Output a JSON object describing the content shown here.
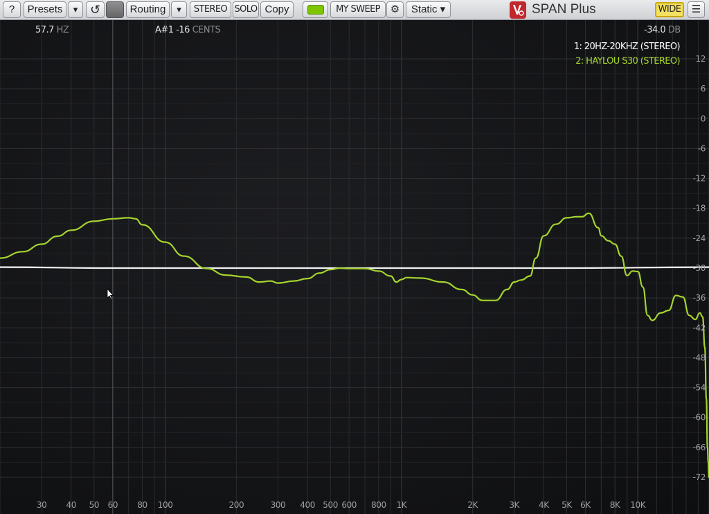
{
  "toolbar": {
    "help_label": "?",
    "presets_label": "Presets",
    "presets_arrow": "▾",
    "reset_icon": "↺",
    "routing_label": "Routing",
    "routing_arrow": "▾",
    "stereo_label": "STEREO",
    "solo_label": "SOLO",
    "copy_label": "Copy",
    "sweep_label": "MY SWEEP",
    "settings_icon": "⚙",
    "mode_label": "Static ▾",
    "brand": "SPAN Plus",
    "wide_label": "WIDE",
    "menu_icon": "☰"
  },
  "readouts": {
    "freq_value": "57.7",
    "freq_unit": "HZ",
    "note_value": "A#1",
    "cents_value": "-16",
    "cents_unit": "CENTS",
    "db_value": "-34.0",
    "db_unit": "DB"
  },
  "legend": [
    {
      "label": "1: 20HZ-20KHZ (STEREO)",
      "color": "#ffffff"
    },
    {
      "label": "2: HAYLOU S30 (STEREO)",
      "color": "#a6d42e"
    }
  ],
  "colors": {
    "accent_green": "#7ec500",
    "trace_green": "#a6d42e",
    "trace_white": "#f2f2f2",
    "wide_yellow": "#f4e060"
  },
  "chart_data": {
    "type": "line",
    "x_scale": "log",
    "xlim": [
      20,
      20000
    ],
    "ylim": [
      -72,
      12
    ],
    "grid": true,
    "x_ticks": [
      {
        "v": 30,
        "label": "30"
      },
      {
        "v": 40,
        "label": "40"
      },
      {
        "v": 50,
        "label": "50"
      },
      {
        "v": 60,
        "label": "60"
      },
      {
        "v": 80,
        "label": "80"
      },
      {
        "v": 100,
        "label": "100"
      },
      {
        "v": 200,
        "label": "200"
      },
      {
        "v": 300,
        "label": "300"
      },
      {
        "v": 400,
        "label": "400"
      },
      {
        "v": 500,
        "label": "500"
      },
      {
        "v": 600,
        "label": "600"
      },
      {
        "v": 800,
        "label": "800"
      },
      {
        "v": 1000,
        "label": "1K"
      },
      {
        "v": 2000,
        "label": "2K"
      },
      {
        "v": 3000,
        "label": "3K"
      },
      {
        "v": 4000,
        "label": "4K"
      },
      {
        "v": 5000,
        "label": "5K"
      },
      {
        "v": 6000,
        "label": "6K"
      },
      {
        "v": 8000,
        "label": "8K"
      },
      {
        "v": 10000,
        "label": "10K"
      }
    ],
    "y_ticks": [
      12,
      6,
      0,
      -6,
      -12,
      -18,
      -24,
      -30,
      -36,
      -42,
      -48,
      -54,
      -60,
      -66,
      -72
    ],
    "series": [
      {
        "name": "1: 20HZ-20KHZ (STEREO)",
        "color": "#f2f2f2",
        "points": [
          [
            20,
            -29.8
          ],
          [
            60,
            -30
          ],
          [
            150,
            -30
          ],
          [
            1000,
            -30
          ],
          [
            5000,
            -30
          ],
          [
            20000,
            -29.8
          ]
        ]
      },
      {
        "name": "2: HAYLOU S30 (STEREO)",
        "color": "#a6d42e",
        "points": [
          [
            20,
            -28
          ],
          [
            25,
            -26.7
          ],
          [
            30,
            -25.2
          ],
          [
            35,
            -23.6
          ],
          [
            40,
            -22.4
          ],
          [
            50,
            -20.6
          ],
          [
            60,
            -20.1
          ],
          [
            70,
            -19.9
          ],
          [
            75,
            -20.1
          ],
          [
            80,
            -21.3
          ],
          [
            100,
            -24.8
          ],
          [
            120,
            -27.6
          ],
          [
            150,
            -30.1
          ],
          [
            180,
            -31.4
          ],
          [
            220,
            -31.8
          ],
          [
            250,
            -32.8
          ],
          [
            280,
            -32.6
          ],
          [
            300,
            -33
          ],
          [
            350,
            -32.6
          ],
          [
            400,
            -32.1
          ],
          [
            450,
            -31
          ],
          [
            500,
            -30.3
          ],
          [
            550,
            -30
          ],
          [
            600,
            -30.1
          ],
          [
            700,
            -30.1
          ],
          [
            800,
            -30.6
          ],
          [
            900,
            -31.6
          ],
          [
            950,
            -32.8
          ],
          [
            1000,
            -32.3
          ],
          [
            1050,
            -31.9
          ],
          [
            1200,
            -32
          ],
          [
            1500,
            -32.8
          ],
          [
            1800,
            -34.3
          ],
          [
            2000,
            -35.4
          ],
          [
            2200,
            -36.5
          ],
          [
            2500,
            -36.5
          ],
          [
            2800,
            -34.3
          ],
          [
            3000,
            -32.8
          ],
          [
            3200,
            -32.4
          ],
          [
            3500,
            -31.6
          ],
          [
            3700,
            -28
          ],
          [
            4000,
            -23.5
          ],
          [
            4500,
            -21.2
          ],
          [
            5000,
            -19.9
          ],
          [
            5500,
            -19.7
          ],
          [
            5800,
            -19.7
          ],
          [
            6200,
            -19
          ],
          [
            6800,
            -21.9
          ],
          [
            7000,
            -23.5
          ],
          [
            7500,
            -24.5
          ],
          [
            8000,
            -25.2
          ],
          [
            8500,
            -27.6
          ],
          [
            9000,
            -31.5
          ],
          [
            9500,
            -30.6
          ],
          [
            10000,
            -30.7
          ],
          [
            10500,
            -33.8
          ],
          [
            11000,
            -39.5
          ],
          [
            11500,
            -40.5
          ],
          [
            12500,
            -39
          ],
          [
            13500,
            -38.5
          ],
          [
            14500,
            -35.5
          ],
          [
            15500,
            -35.8
          ],
          [
            16500,
            -39.5
          ],
          [
            17500,
            -40.3
          ],
          [
            18300,
            -39
          ],
          [
            18800,
            -39.8
          ],
          [
            19200,
            -45.9
          ],
          [
            19500,
            -56.3
          ],
          [
            19700,
            -66
          ],
          [
            19850,
            -68.9
          ],
          [
            20000,
            -72
          ]
        ]
      }
    ]
  }
}
